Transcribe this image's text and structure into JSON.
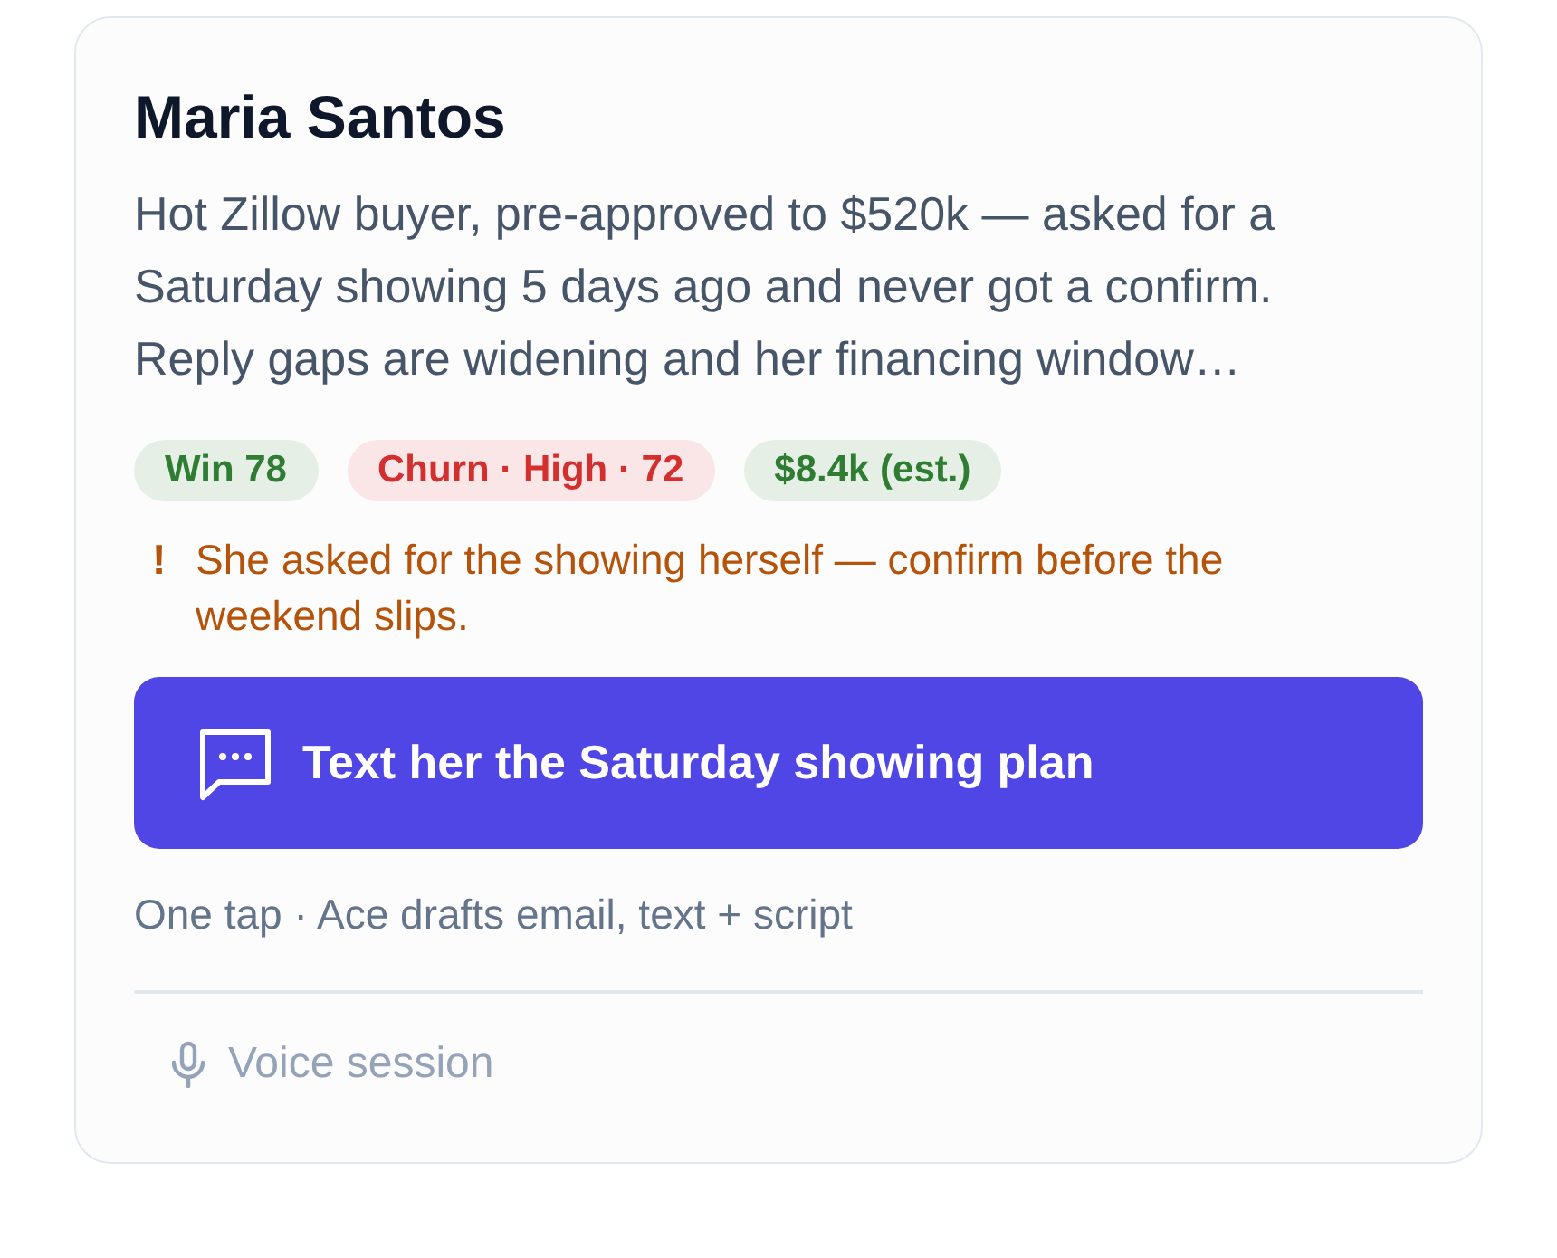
{
  "card": {
    "title": "Maria Santos",
    "summary": "Hot Zillow buyer, pre-approved to $520k — asked for a Saturday showing 5 days ago and never got a confirm. Reply gaps are widening and her financing window…"
  },
  "badges": [
    {
      "text": "Win 78",
      "color": "#2e7d32"
    },
    {
      "text": "Churn · High · 72",
      "color": "#d32f2f"
    },
    {
      "text": "$8.4k (est.)",
      "color": "#2e7d32"
    }
  ],
  "alert": {
    "mark": "!",
    "text": "She asked for the showing herself — confirm before the weekend slips."
  },
  "primary_action": {
    "label": "Text her the Saturday showing plan"
  },
  "action_note": "One tap · Ace drafts email, text + script",
  "voice_button": {
    "label": "Voice session",
    "disabled": true
  }
}
